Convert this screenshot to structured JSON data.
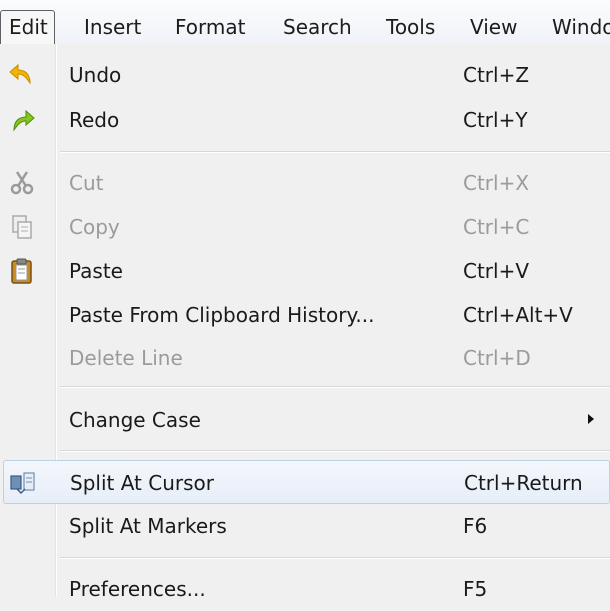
{
  "menubar": {
    "items": [
      "Edit",
      "Insert",
      "Format",
      "Search",
      "Tools",
      "View",
      "Windo"
    ]
  },
  "menu": {
    "undo": {
      "label": "Undo",
      "shortcut": "Ctrl+Z",
      "icon": "undo-icon"
    },
    "redo": {
      "label": "Redo",
      "shortcut": "Ctrl+Y",
      "icon": "redo-icon"
    },
    "cut": {
      "label": "Cut",
      "shortcut": "Ctrl+X",
      "icon": "scissors-icon",
      "disabled": true
    },
    "copy": {
      "label": "Copy",
      "shortcut": "Ctrl+C",
      "icon": "copy-icon",
      "disabled": true
    },
    "paste": {
      "label": "Paste",
      "shortcut": "Ctrl+V",
      "icon": "clipboard-icon"
    },
    "paste_history": {
      "label": "Paste From Clipboard History...",
      "shortcut": "Ctrl+Alt+V"
    },
    "delete_line": {
      "label": "Delete Line",
      "shortcut": "Ctrl+D",
      "disabled": true
    },
    "change_case": {
      "label": "Change Case",
      "submenu": true
    },
    "split_cursor": {
      "label": "Split At Cursor",
      "shortcut": "Ctrl+Return",
      "icon": "split-icon",
      "highlighted": true
    },
    "split_markers": {
      "label": "Split At Markers",
      "shortcut": "F6"
    },
    "preferences": {
      "label": "Preferences...",
      "shortcut": "F5"
    }
  },
  "colors": {
    "menu_bg": "#f0f0f0",
    "disabled_text": "#9b9b9b",
    "highlight_border": "#bed0e6",
    "undo_arrow": "#f0b000",
    "redo_arrow": "#7bbf1e"
  }
}
